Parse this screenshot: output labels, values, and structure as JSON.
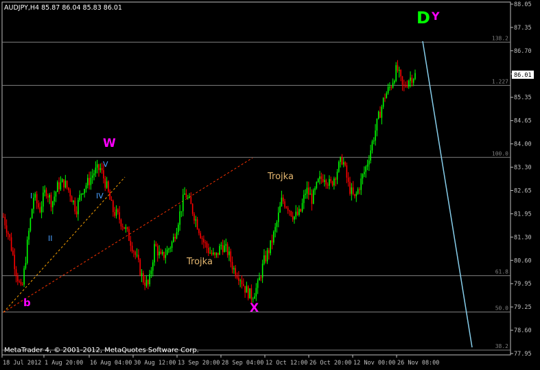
{
  "header": {
    "symbol_text": "AUDJPY,H4  85.87 86.04 85.83 86.01"
  },
  "footer": {
    "copyright": "MetaTrader 4, © 2001-2012, MetaQuotes Software Corp."
  },
  "colors": {
    "background": "#000000",
    "axis": "#c0c0c0",
    "bull": "#00ff00",
    "bear": "#ff0000",
    "fib": "#808080",
    "wave_pink": "#ff00ff",
    "wave_green": "#00ff00",
    "wave_blue": "#4aa0ff",
    "trojka": "#e6b870",
    "cyan_line": "#87ceeb",
    "trend_orange": "#ffa500",
    "trend_red": "#ff3300"
  },
  "chart_data": {
    "type": "candlestick",
    "symbol": "AUDJPY",
    "timeframe": "H4",
    "ohlc_last": {
      "open": 85.87,
      "high": 86.04,
      "low": 85.83,
      "close": 86.01
    },
    "current_price_label": "86.01",
    "y_ticks": [
      "88.05",
      "87.35",
      "86.70",
      "86.00",
      "85.35",
      "84.65",
      "84.00",
      "83.30",
      "82.65",
      "81.95",
      "81.30",
      "80.60",
      "79.95",
      "79.25",
      "78.60",
      "77.95"
    ],
    "x_ticks": [
      "18 Jul 2012",
      "1 Aug 20:00",
      "16 Aug 04:00",
      "30 Aug 12:00",
      "13 Sep 20:00",
      "28 Sep 04:00",
      "12 Oct 12:00",
      "26 Oct 20:00",
      "12 Nov 00:00",
      "26 Nov 08:00"
    ],
    "ylim": [
      77.95,
      88.05
    ],
    "fib_levels": [
      {
        "label": "138.2",
        "price": 86.95
      },
      {
        "label": "1.227",
        "price": 85.7
      },
      {
        "label": "100.0",
        "price": 83.62
      },
      {
        "label": "61.8",
        "price": 80.2
      },
      {
        "label": "50.0",
        "price": 79.15
      },
      {
        "label": "38.2",
        "price": 78.05
      }
    ],
    "price_path": [
      [
        0,
        81.9
      ],
      [
        1,
        81.3
      ],
      [
        2,
        80.4
      ],
      [
        3,
        79.7
      ],
      [
        4,
        81.2
      ],
      [
        5,
        82.5
      ],
      [
        6,
        82.1
      ],
      [
        7,
        82.7
      ],
      [
        8,
        82.3
      ],
      [
        9,
        82.8
      ],
      [
        10,
        82.9
      ],
      [
        11,
        82.6
      ],
      [
        12,
        82.1
      ],
      [
        13,
        82.7
      ],
      [
        14,
        82.9
      ],
      [
        15,
        83.2
      ],
      [
        16,
        83.3
      ],
      [
        17,
        82.8
      ],
      [
        18,
        82.1
      ],
      [
        19,
        81.9
      ],
      [
        20,
        81.6
      ],
      [
        21,
        81.2
      ],
      [
        22,
        80.7
      ],
      [
        23,
        80.1
      ],
      [
        24,
        79.9
      ],
      [
        25,
        81.1
      ],
      [
        26,
        80.7
      ],
      [
        27,
        80.9
      ],
      [
        28,
        81.2
      ],
      [
        29,
        81.9
      ],
      [
        30,
        82.6
      ],
      [
        31,
        82.2
      ],
      [
        32,
        81.7
      ],
      [
        33,
        81.2
      ],
      [
        34,
        80.9
      ],
      [
        35,
        80.7
      ],
      [
        36,
        81.1
      ],
      [
        37,
        80.9
      ],
      [
        38,
        80.4
      ],
      [
        39,
        80.2
      ],
      [
        40,
        79.8
      ],
      [
        41,
        79.6
      ],
      [
        42,
        79.9
      ],
      [
        43,
        80.6
      ],
      [
        44,
        81.0
      ],
      [
        45,
        81.6
      ],
      [
        46,
        82.4
      ],
      [
        47,
        82.2
      ],
      [
        48,
        81.9
      ],
      [
        49,
        82.0
      ],
      [
        50,
        82.7
      ],
      [
        51,
        82.4
      ],
      [
        52,
        82.9
      ],
      [
        53,
        83.1
      ],
      [
        54,
        82.8
      ],
      [
        55,
        83.2
      ],
      [
        56,
        83.6
      ],
      [
        57,
        82.8
      ],
      [
        58,
        82.4
      ],
      [
        59,
        82.9
      ],
      [
        60,
        83.4
      ],
      [
        61,
        84.1
      ],
      [
        62,
        84.8
      ],
      [
        63,
        85.4
      ],
      [
        64,
        85.7
      ],
      [
        65,
        86.2
      ],
      [
        66,
        85.6
      ],
      [
        67,
        85.9
      ],
      [
        68,
        86.0
      ]
    ],
    "annotations": [
      {
        "text": "D",
        "color": "wave_green"
      },
      {
        "text": "Y",
        "color": "wave_pink"
      },
      {
        "text": "W",
        "color": "wave_pink"
      },
      {
        "text": "X",
        "color": "wave_pink"
      },
      {
        "text": "b",
        "color": "wave_pink"
      },
      {
        "text": "I",
        "color": "wave_blue"
      },
      {
        "text": "II",
        "color": "wave_blue"
      },
      {
        "text": "IV",
        "color": "wave_blue"
      },
      {
        "text": "V",
        "color": "wave_blue"
      },
      {
        "text": "Trojka",
        "color": "trojka"
      },
      {
        "text": "Trojka",
        "color": "trojka"
      }
    ]
  }
}
